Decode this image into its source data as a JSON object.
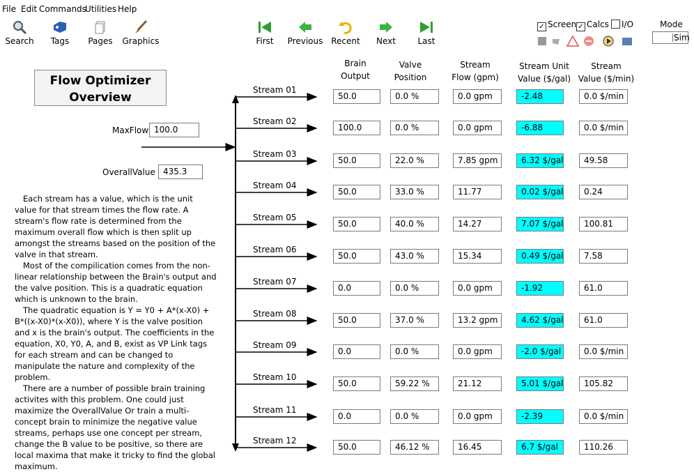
{
  "menu": [
    "File",
    "Edit",
    "Commands",
    "Utilities",
    "Help"
  ],
  "toolbar": {
    "left": [
      {
        "label": "Search",
        "icon": "search-icon"
      },
      {
        "label": "Tags",
        "icon": "tags-icon"
      },
      {
        "label": "Pages",
        "icon": "pages-icon"
      },
      {
        "label": "Graphics",
        "icon": "graphics-icon"
      }
    ],
    "nav": [
      {
        "label": "First",
        "icon": "first-icon"
      },
      {
        "label": "Previous",
        "icon": "previous-icon"
      },
      {
        "label": "Recent",
        "icon": "recent-icon"
      },
      {
        "label": "Next",
        "icon": "next-icon"
      },
      {
        "label": "Last",
        "icon": "last-icon"
      }
    ],
    "checks": [
      {
        "label": "Screen",
        "checked": true
      },
      {
        "label": "Calcs",
        "checked": true
      },
      {
        "label": "I/O",
        "checked": false
      }
    ],
    "mode_label": "Mode",
    "mode_value": "Sim"
  },
  "title": "Flow Optimizer Overview",
  "maxflow": {
    "label": "MaxFlow",
    "value": "100.0"
  },
  "overall": {
    "label": "OverallValue",
    "value": "435.3"
  },
  "description": [
    "Each stream has a value, which is the unit value for that stream times the flow rate.  A stream's flow rate is determined from the maximum overall flow which is then split up amongst the streams based on the position of the valve in that stream.",
    "Most of the compilication comes from the non-linear relationship between the Brain's output and the valve position.  This is a quadratic equation which is unknown to the brain.",
    "The quadratic equation is Y = Y0 + A*(x-X0) + B*((x-X0)*(x-X0)), where Y is the valve position and x is the brain's output.  The coefficients in the equation, X0, Y0, A, and B, exist as VP Link tags for each stream and can be changed to manipulate the nature and complexity of the problem.",
    "There are a number of possible brain training activites with this problem.  One could just maximize the OverallValue  Or train a multi-concept brain to minimize the negative value streams, perhaps use one concept per stream, change the B value to be positive, so there are local maxima that make it tricky to find the global maximum."
  ],
  "headers": {
    "brain": "Brain\nOutput",
    "valve": "Valve\nPosition",
    "flow": "Stream\nFlow (gpm)",
    "unit": "Stream Unit\nValue ($/gal)",
    "value": "Stream\nValue ($/min)"
  },
  "streams": [
    {
      "name": "Stream 01",
      "brain": "50.0",
      "valve": "0.0 %",
      "flow": "0.0 gpm",
      "unit": "-2.48",
      "value": "0.0 $/min"
    },
    {
      "name": "Stream 02",
      "brain": "100.0",
      "valve": "0.0 %",
      "flow": "0.0 gpm",
      "unit": "-6.88",
      "value": "0.0 $/min"
    },
    {
      "name": "Stream 03",
      "brain": "50.0",
      "valve": "22.0 %",
      "flow": "7.85 gpm",
      "unit": "6.32 $/gal",
      "value": "49.58"
    },
    {
      "name": "Stream 04",
      "brain": "50.0",
      "valve": "33.0 %",
      "flow": "11.77",
      "unit": "0.02 $/gal",
      "value": "0.24"
    },
    {
      "name": "Stream 05",
      "brain": "50.0",
      "valve": "40.0 %",
      "flow": "14.27",
      "unit": "7.07 $/gal",
      "value": "100.81"
    },
    {
      "name": "Stream 06",
      "brain": "50.0",
      "valve": "43.0 %",
      "flow": "15.34",
      "unit": "0.49 $/gal",
      "value": "7.58"
    },
    {
      "name": "Stream 07",
      "brain": "0.0",
      "valve": "0.0 %",
      "flow": "0.0 gpm",
      "unit": "-1.92",
      "value": "61.0"
    },
    {
      "name": "Stream 08",
      "brain": "50.0",
      "valve": "37.0 %",
      "flow": "13.2 gpm",
      "unit": "4.62 $/gal",
      "value": "61.0"
    },
    {
      "name": "Stream 09",
      "brain": "0.0",
      "valve": "0.0 %",
      "flow": "0.0 gpm",
      "unit": "-2.0 $/gal",
      "value": "0.0 $/min"
    },
    {
      "name": "Stream 10",
      "brain": "50.0",
      "valve": "59.22 %",
      "flow": "21.12",
      "unit": "5.01 $/gal",
      "value": "105.82"
    },
    {
      "name": "Stream 11",
      "brain": "0.0",
      "valve": "0.0 %",
      "flow": "0.0 gpm",
      "unit": "-2.39",
      "value": "0.0 $/min"
    },
    {
      "name": "Stream 12",
      "brain": "50.0",
      "valve": "46.12 %",
      "flow": "16.45",
      "unit": "6.7 $/gal",
      "value": "110.26"
    }
  ],
  "colors": {
    "unit_value_bg": "#00ffff",
    "first_last": "#2e9e2e",
    "prev_next": "#3bb43b",
    "recent": "#e8b400"
  }
}
